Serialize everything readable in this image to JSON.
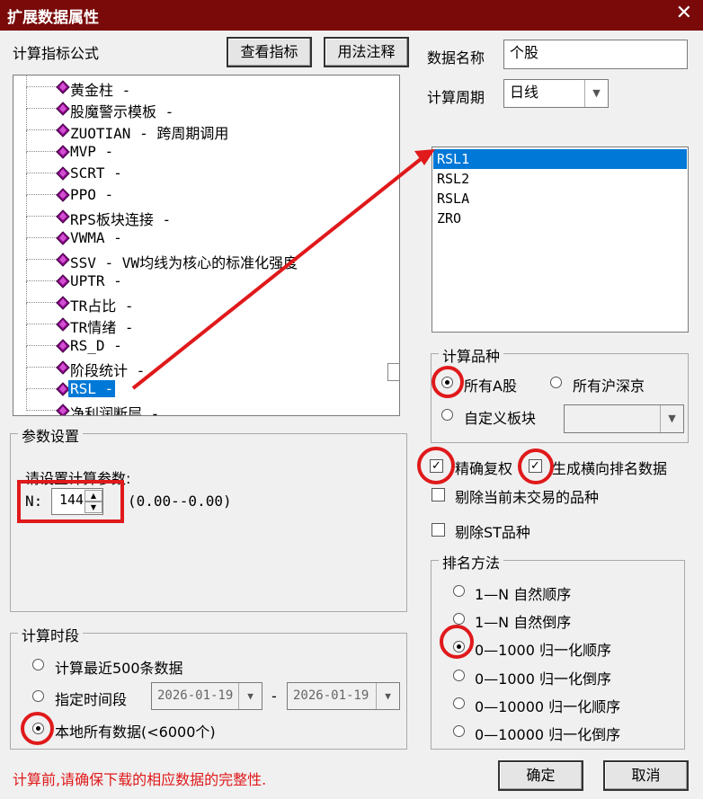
{
  "window": {
    "title": "扩展数据属性"
  },
  "formula": {
    "section_label": "计算指标公式",
    "view_button": "查看指标",
    "usage_button": "用法注释",
    "tree_items": [
      "黄金柱 -",
      "股魔警示模板 -",
      "ZUOTIAN - 跨周期调用",
      "MVP -",
      "SCRT -",
      "PPO -",
      "RPS板块连接 -",
      "VWMA -",
      "SSV - VW均线为核心的标准化强度",
      "UPTR -",
      "TR占比 -",
      "TR情绪 -",
      "RS_D -",
      "阶段统计 -",
      "RSL -",
      "净利润断层 -"
    ],
    "selected_index": 14
  },
  "data_name": {
    "label": "数据名称",
    "value": "个股"
  },
  "period": {
    "label": "计算周期",
    "value": "日线"
  },
  "outputs": {
    "items": [
      "RSL1",
      "RSL2",
      "RSLA",
      "ZRO"
    ],
    "selected_index": 0
  },
  "params": {
    "section_label": "参数设置",
    "prompt": "请设置计算参数:",
    "n_label": "N:",
    "n_value": "144",
    "range": "(0.00--0.00)"
  },
  "variety": {
    "section_label": "计算品种",
    "all_a": "所有A股",
    "all_hs": "所有沪深京",
    "custom": "自定义板块",
    "selected": "all_a"
  },
  "options": {
    "precise_adjust": "精确复权",
    "gen_rank": "生成横向排名数据",
    "exclude_untraded": "剔除当前未交易的品种",
    "exclude_st": "剔除ST品种"
  },
  "ranking": {
    "section_label": "排名方法",
    "items": [
      "1—N 自然顺序",
      "1—N 自然倒序",
      "0—1000 归一化顺序",
      "0—1000 归一化倒序",
      "0—10000 归一化顺序",
      "0—10000 归一化倒序"
    ],
    "selected_index": 2
  },
  "period_range": {
    "section_label": "计算时段",
    "recent": "计算最近500条数据",
    "specified": "指定时间段",
    "start_date": "2026-01-19",
    "dash": "-",
    "end_date": "2026-01-19",
    "all_local": "本地所有数据(<6000个)",
    "selected": "all_local"
  },
  "footer": {
    "warning": "计算前,请确保下载的相应数据的完整性.",
    "ok": "确定",
    "cancel": "取消"
  },
  "colors": {
    "titlebar": "#7a0a0a",
    "selection": "#0078d7",
    "annotation": "#e0191b",
    "warning": "#e0191b",
    "gem": "#8b008b"
  }
}
